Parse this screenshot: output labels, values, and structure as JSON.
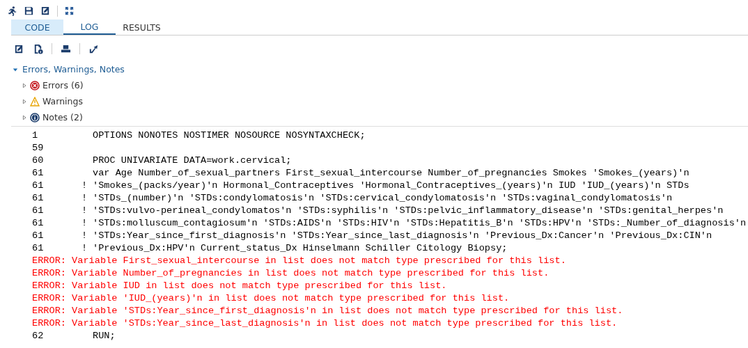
{
  "tabs": [
    {
      "label": "CODE",
      "selected": false,
      "highlighted": true
    },
    {
      "label": "LOG",
      "selected": true,
      "highlighted": false
    },
    {
      "label": "RESULTS",
      "selected": false,
      "highlighted": false
    }
  ],
  "messages": {
    "label": "Errors, Warnings, Notes",
    "expanded": true,
    "children": [
      {
        "kind": "error",
        "label": "Errors (6)",
        "expanded": false
      },
      {
        "kind": "warning",
        "label": "Warnings",
        "expanded": false
      },
      {
        "kind": "note",
        "label": "Notes (2)",
        "expanded": false
      }
    ]
  },
  "log": [
    {
      "kind": "source",
      "number": "1",
      "text": "OPTIONS NONOTES NOSTIMER NOSOURCE NOSYNTAXCHECK;"
    },
    {
      "kind": "source",
      "number": "59"
    },
    {
      "kind": "source",
      "number": "60",
      "text": "PROC UNIVARIATE DATA=work.cervical;"
    },
    {
      "kind": "source",
      "number": "61",
      "text": "var Age Number_of_sexual_partners First_sexual_intercourse Number_of_pregnancies Smokes 'Smokes_(years)'n"
    },
    {
      "kind": "source",
      "number": "61",
      "marker": "!",
      "text": "'Smokes_(packs/year)'n Hormonal_Contraceptives 'Hormonal_Contraceptives_(years)'n IUD 'IUD_(years)'n STDs"
    },
    {
      "kind": "source",
      "number": "61",
      "marker": "!",
      "text": "'STDs_(number)'n 'STDs:condylomatosis'n 'STDs:cervical_condylomatosis'n 'STDs:vaginal_condylomatosis'n"
    },
    {
      "kind": "source",
      "number": "61",
      "marker": "!",
      "text": "'STDs:vulvo-perineal_condylomatos'n 'STDs:syphilis'n 'STDs:pelvic_inflammatory_disease'n 'STDs:genital_herpes'n"
    },
    {
      "kind": "source",
      "number": "61",
      "marker": "!",
      "text": "'STDs:molluscum_contagiosum'n 'STDs:AIDS'n 'STDs:HIV'n 'STDs:Hepatitis_B'n 'STDs:HPV'n 'STDs:_Number_of_diagnosis'n"
    },
    {
      "kind": "source",
      "number": "61",
      "marker": "!",
      "text": "'STDs:Year_since_first_diagnosis'n 'STDs:Year_since_last_diagnosis'n 'Previous_Dx:Cancer'n 'Previous_Dx:CIN'n"
    },
    {
      "kind": "source",
      "number": "61",
      "marker": "!",
      "text": "'Previous_Dx:HPV'n Current_status_Dx Hinselmann Schiller Citology Biopsy;"
    },
    {
      "kind": "error",
      "text": "ERROR: Variable First_sexual_intercourse in list does not match type prescribed for this list."
    },
    {
      "kind": "error",
      "text": "ERROR: Variable Number_of_pregnancies in list does not match type prescribed for this list."
    },
    {
      "kind": "error",
      "text": "ERROR: Variable IUD in list does not match type prescribed for this list."
    },
    {
      "kind": "error",
      "text": "ERROR: Variable 'IUD_(years)'n in list does not match type prescribed for this list."
    },
    {
      "kind": "error",
      "text": "ERROR: Variable 'STDs:Year_since_first_diagnosis'n in list does not match type prescribed for this list."
    },
    {
      "kind": "error",
      "text": "ERROR: Variable 'STDs:Year_since_last_diagnosis'n in list does not match type prescribed for this list."
    },
    {
      "kind": "source",
      "number": "62",
      "text": "RUN;"
    }
  ]
}
